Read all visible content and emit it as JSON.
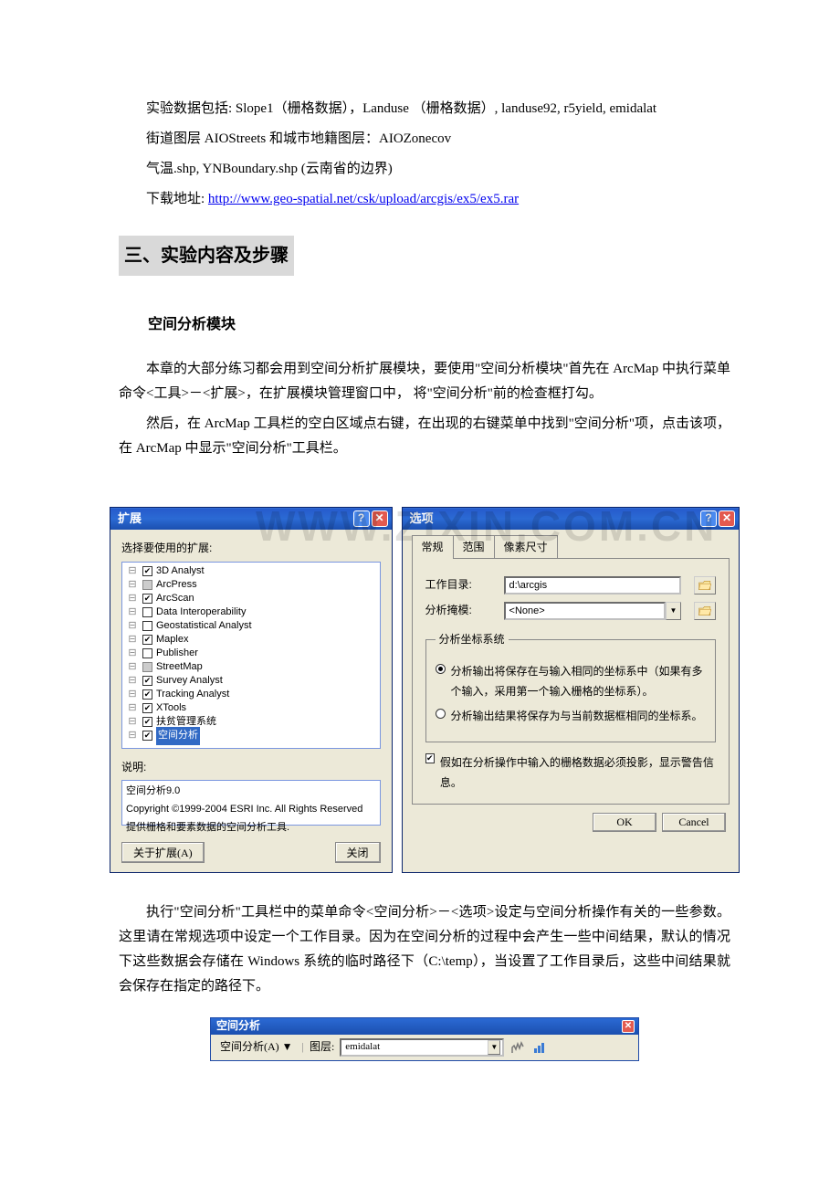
{
  "intro": {
    "line1": "实验数据包括: Slope1（栅格数据），Landuse （栅格数据）, landuse92, r5yield, emidalat",
    "line2": "街道图层 AIOStreets 和城市地籍图层：AIOZonecov",
    "line3": "气温.shp, YNBoundary.shp (云南省的边界)",
    "line4_prefix": "下载地址: ",
    "line4_link": "http://www.geo-spatial.net/csk/upload/arcgis/ex5/ex5.rar"
  },
  "section_title": "三、实验内容及步骤",
  "subheader": "空间分析模块",
  "para1": "本章的大部分练习都会用到空间分析扩展模块，要使用\"空间分析模块\"首先在 ArcMap 中执行菜单命令<工具>－<扩展>，在扩展模块管理窗口中，  将\"空间分析\"前的检查框打勾。",
  "para2": "然后，在 ArcMap 工具栏的空白区域点右键，在出现的右键菜单中找到\"空间分析\"项，点击该项，在 ArcMap 中显示\"空间分析\"工具栏。",
  "para3": "执行\"空间分析\"工具栏中的菜单命令<空间分析>－<选项>设定与空间分析操作有关的一些参数。这里请在常规选项中设定一个工作目录。因为在空间分析的过程中会产生一些中间结果，默认的情况下这些数据会存储在 Windows 系统的临时路径下（C:\\temp），当设置了工作目录后，这些中间结果就会保存在指定的路径下。",
  "extensions": {
    "title": "扩展",
    "prompt": "选择要使用的扩展:",
    "items": [
      {
        "label": "3D Analyst",
        "checked": true,
        "type": "check"
      },
      {
        "label": "ArcPress",
        "checked": false,
        "type": "gray"
      },
      {
        "label": "ArcScan",
        "checked": true,
        "type": "check"
      },
      {
        "label": "Data Interoperability",
        "checked": false,
        "type": "box"
      },
      {
        "label": "Geostatistical Analyst",
        "checked": false,
        "type": "box"
      },
      {
        "label": "Maplex",
        "checked": true,
        "type": "check"
      },
      {
        "label": "Publisher",
        "checked": false,
        "type": "box"
      },
      {
        "label": "StreetMap",
        "checked": false,
        "type": "gray"
      },
      {
        "label": "Survey Analyst",
        "checked": true,
        "type": "check"
      },
      {
        "label": "Tracking Analyst",
        "checked": true,
        "type": "check"
      },
      {
        "label": "XTools",
        "checked": true,
        "type": "check"
      },
      {
        "label": "扶贫管理系统",
        "checked": true,
        "type": "check"
      },
      {
        "label": "空间分析",
        "checked": true,
        "type": "check",
        "selected": true
      }
    ],
    "desc_label": "说明:",
    "desc_l1": "空间分析9.0",
    "desc_l2": "Copyright ©1999-2004 ESRI Inc. All Rights Reserved",
    "desc_l3": "提供栅格和要素数据的空间分析工具.",
    "btn_about": "关于扩展(A)",
    "btn_close": "关闭"
  },
  "options": {
    "title": "选项",
    "tabs": [
      "常规",
      "范围",
      "像素尺寸"
    ],
    "workdir_label": "工作目录:",
    "workdir_value": "d:\\arcgis",
    "mask_label": "分析掩模:",
    "mask_value": "<None>",
    "fieldset_legend": "分析坐标系统",
    "radio1": "分析输出将保存在与输入相同的坐标系中（如果有多个输入，采用第一个输入栅格的坐标系）。",
    "radio2": "分析输出结果将保存为与当前数据框相同的坐标系。",
    "check_warn": "假如在分析操作中输入的栅格数据必须投影，显示警告信息。",
    "btn_ok": "OK",
    "btn_cancel": "Cancel"
  },
  "toolbar": {
    "title": "空间分析",
    "menu": "空间分析(A) ▼",
    "layer_label": "图层:",
    "layer_value": "emidalat"
  },
  "watermark": "WWW.ZIXIN.COM.CN"
}
